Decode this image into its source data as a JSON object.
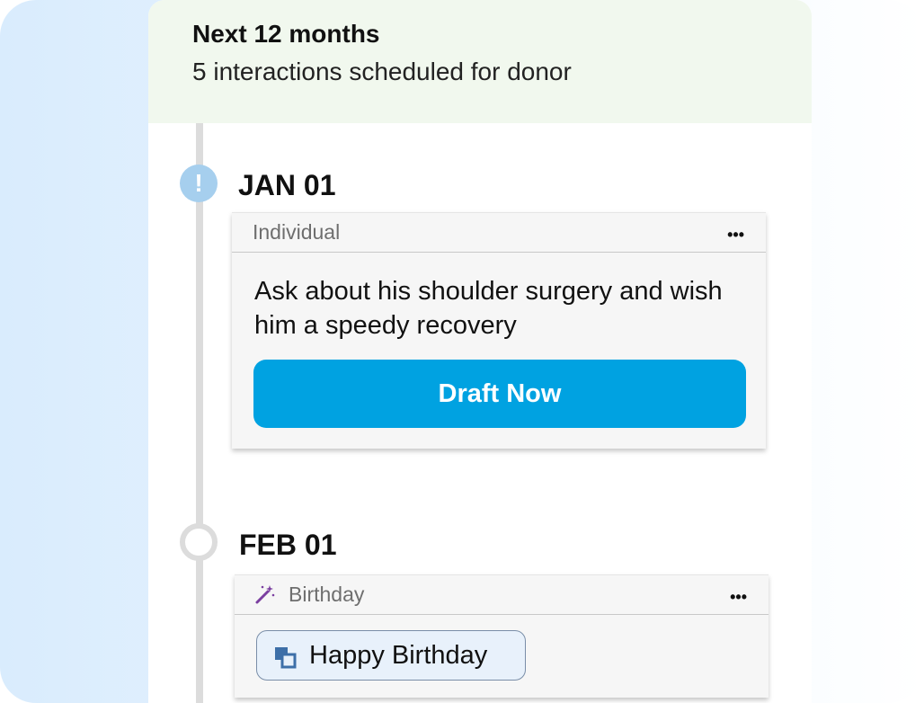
{
  "header": {
    "title": "Next 12 months",
    "subtitle": "5 interactions scheduled for donor"
  },
  "timeline": [
    {
      "date": "JAN 01",
      "marker": "exclamation-icon",
      "marker_glyph": "!",
      "card": {
        "type_label": "Individual",
        "menu_glyph": "•••",
        "body": "Ask about his shoulder surgery and wish him a speedy recovery",
        "action_label": "Draft Now"
      }
    },
    {
      "date": "FEB 01",
      "marker": "empty-ring",
      "card": {
        "type_icon": "magic-wand-icon",
        "type_label": "Birthday",
        "menu_glyph": "•••",
        "chip_icon": "copy-template-icon",
        "chip_label": "Happy Birthday"
      }
    }
  ],
  "colors": {
    "header_bg": "#f1f8ee",
    "accent": "#00a2e1",
    "alert_marker": "#a6cfee",
    "wand": "#7b3fa0",
    "chip_icon": "#3d6fa8"
  }
}
